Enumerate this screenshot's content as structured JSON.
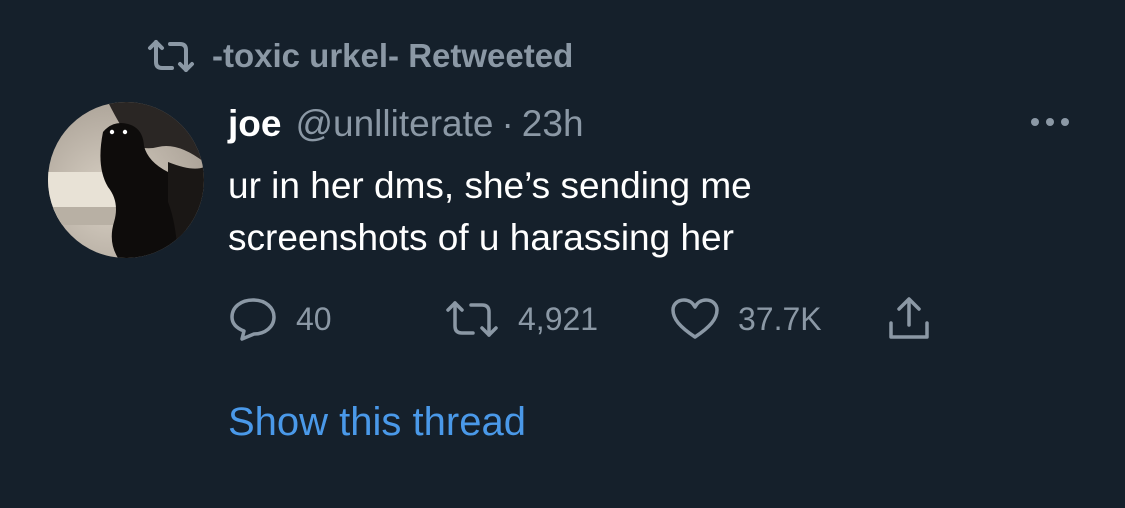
{
  "social_context": {
    "icon": "retweet-icon",
    "text": "-toxic urkel- Retweeted"
  },
  "tweet": {
    "author_name": "joe",
    "handle": "@unlliterate",
    "separator": "·",
    "time": "23h",
    "text_lines": [
      "ur in her dms, she’s sending me",
      "screenshots of u harassing her"
    ],
    "more_icon": "more-horizontal-icon"
  },
  "actions": {
    "reply": {
      "icon": "reply-icon",
      "count": "40"
    },
    "retweet": {
      "icon": "retweet-icon",
      "count": "4,921"
    },
    "like": {
      "icon": "heart-icon",
      "count": "37.7K"
    },
    "share": {
      "icon": "share-icon"
    }
  },
  "show_thread": "Show this thread",
  "colors": {
    "background": "#15202b",
    "primary_text": "#ffffff",
    "secondary_text": "#8b98a5",
    "link": "#4a99e9"
  }
}
